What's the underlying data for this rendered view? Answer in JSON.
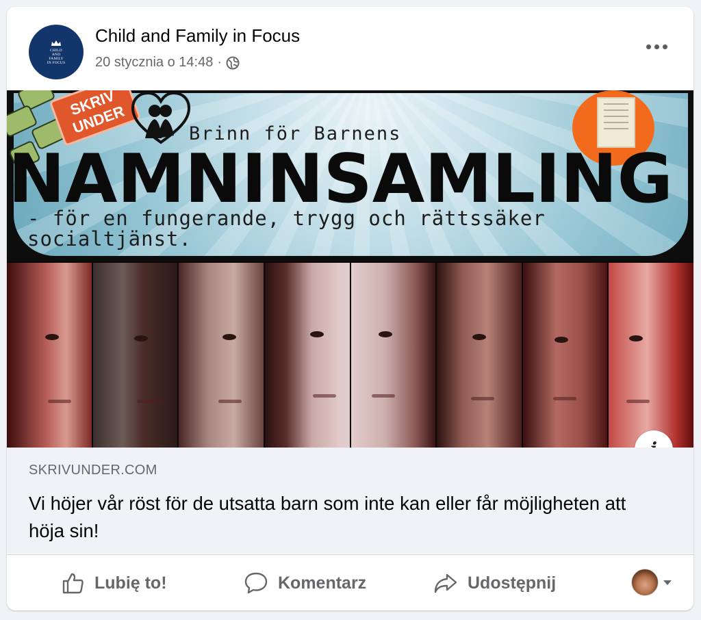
{
  "post": {
    "page_name": "Child and Family in Focus",
    "avatar_text": "CHILD\nAND\nFAMILY\nIN FOCUS",
    "timestamp": "20 stycznia o 14:48",
    "separator": "·",
    "audience_icon": "globe-icon",
    "more_icon": "more-options-icon"
  },
  "image": {
    "badge": "SKRIV UNDER",
    "line1": "Brinn för Barnens",
    "headline": "NAMNINSAMLING",
    "subline": "- för en fungerande, trygg och rättssäker\n  socialtjänst.",
    "info_label": "i"
  },
  "link": {
    "domain": "SKRIVUNDER.COM",
    "title": "Vi höjer vår röst för de utsatta barn som inte kan eller får möjligheten att höja sin!"
  },
  "actions": {
    "like": "Lubię to!",
    "comment": "Komentarz",
    "share": "Udostępnij"
  },
  "colors": {
    "brand_navy": "#12356b",
    "text_secondary": "#65676b",
    "link_bg": "#f0f2f5",
    "badge_orange": "#e0572c"
  }
}
